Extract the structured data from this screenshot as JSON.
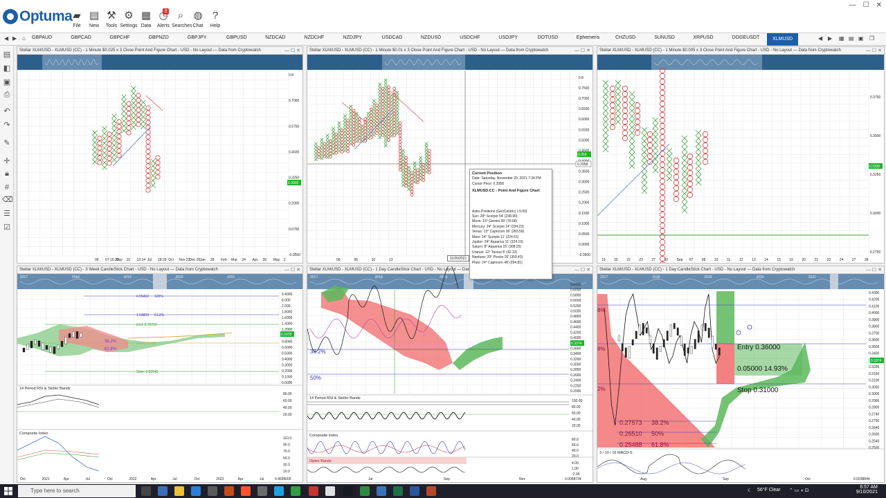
{
  "app": {
    "logo_text": "Optuma",
    "ribbon": [
      {
        "label": "File",
        "icon": "folder-icon"
      },
      {
        "label": "New",
        "icon": "new-page-icon"
      },
      {
        "label": "Tools",
        "icon": "tools-icon"
      },
      {
        "label": "Settings",
        "icon": "gear-icon"
      },
      {
        "label": "Data",
        "icon": "data-icon"
      },
      {
        "label": "Alerts",
        "icon": "clock-icon",
        "badge": "3"
      },
      {
        "label": "Searches",
        "icon": "search-icon"
      },
      {
        "label": "Chat",
        "icon": "chat-icon"
      },
      {
        "label": "Help",
        "icon": "help-icon"
      }
    ],
    "accent": "#1c5fa8"
  },
  "tabs": {
    "items": [
      "GBPAUD",
      "GBPCAD",
      "GBPCHF",
      "GBPNZD",
      "GBPJPY",
      "GBPUSD",
      "NZDCAD",
      "NZDCHF",
      "NZDJPY",
      "USDCAD",
      "NZDUSD",
      "USDCHF",
      "USDJPY",
      "DOTUSD",
      "Ephemeris",
      "CHZUSD",
      "SUNUSD",
      "XRPUSD",
      "DOGEUSDT",
      "XLMUSD"
    ],
    "active": "XLMUSD"
  },
  "panels": [
    {
      "title": "Stellar XLM/USD - XLMUSD (CC) - 1 Minute $0.025 x 3 Close Point And Figure Chart - USD - No Layout — Data from Cryptowatch",
      "yticks": [
        "0.8",
        "0.7000",
        "0.5750",
        "0.4500",
        "0.3250",
        "0.2000",
        "0.0750",
        "-0.0500"
      ],
      "xticks": [
        "06",
        "07:16:23",
        "May",
        "10",
        "13:14",
        "Jul",
        "18:29",
        "Oct",
        "Nov 23",
        "Dec 26",
        "Jan",
        "28",
        "Feb",
        "Mar",
        "24",
        "Apr",
        "26",
        "May",
        "2"
      ],
      "price_tag": "0.3000"
    },
    {
      "title": "Stellar XLM/USD - XLMUSD (CC) - 1 Minute $0.01 x 3 Close Point And Figure Chart - USD - No Layout — Data from Cryptowatch",
      "yticks": [
        "0.8",
        "0.7500",
        "0.7000",
        "0.6500",
        "0.6000",
        "0.5500",
        "0.5000",
        "0.4500",
        "0.4000",
        "0.3500",
        "0.3000",
        "0.2500",
        "0.2000",
        "0.1500",
        "0.1000",
        "0.0500",
        "0.0000",
        "-0.0500"
      ],
      "xticks": [
        "06",
        "06",
        "10",
        "13"
      ],
      "price_tag": "0.350",
      "cursor_tag": "0.2958",
      "date_tag": "11/20/2021"
    },
    {
      "title": "Stellar XLM/USD - XLMUSD (CC) - 1 Minute $0.005 x 3 Close Point And Figure Chart - USD - No Layout — Data from Cryptowatch",
      "yticks": [
        "0.3750",
        "0.3500",
        "0.3250",
        "0.3000",
        "0.2750"
      ],
      "xticks": [
        "19",
        "20",
        "22",
        "23",
        "27",
        "30",
        "Sep",
        "07",
        "08",
        "10",
        "11",
        "12",
        "13",
        "14",
        "15",
        "16",
        "20",
        "21",
        "23",
        "24",
        "27",
        "28"
      ],
      "price_tag": "0.3330"
    },
    {
      "title": "Stellar XLM/USD - XLMUSD (CC) - 3 Week CandleStick Chart - USD - No Layout — Data from Cryptowatch",
      "yticks": [
        "6.4000",
        "6.000",
        "2.000",
        "1.8000",
        "1.6000",
        "1.4000",
        "1.2000",
        "1.0000",
        "0.8000",
        "0.6000",
        "0.5000",
        "0.4000",
        "0.3000",
        "0.2000",
        "0.1000",
        "0.0000"
      ],
      "fib": [
        {
          "value": "6.05452",
          "pct": "100%"
        },
        {
          "value": "1.64803",
          "pct": "61.8%"
        }
      ],
      "fib_labels": [
        "End: 0.79760",
        "Ext: 0.20078",
        "Start: 0.02645",
        "38.2%",
        "61.8%"
      ],
      "sub1": "14 Period RSI & Stoller Bands",
      "sub1_ticks": [
        "80.00",
        "60.00",
        "40.00",
        "20.00"
      ],
      "sub2": "Composite Index",
      "sub2_ticks": [
        "110.0",
        "90.0",
        "70.0",
        "50.0",
        "30.0",
        "10.0"
      ],
      "xticks": [
        "Oct",
        "2021",
        "Apr",
        "Jul",
        "Oct",
        "2022",
        "Apr",
        "Jul",
        "Oct",
        "2023",
        "Apr",
        "Jul"
      ],
      "price_tag": "0.3378",
      "corner": "0.4695005",
      "nav": [
        "2017",
        "2018",
        "2019",
        "2020",
        "2021"
      ]
    },
    {
      "title": "Stellar XLM/USD - XLMUSD (CC) - 1 Day CandleStick Chart - USD - No Layout — Data from Cryptowatch",
      "yticks": [
        "0.6400",
        "0.6000",
        "0.5800",
        "0.5600",
        "0.5200",
        "0.5000",
        "0.4800",
        "0.4600",
        "0.4400",
        "0.4200",
        "0.4000",
        "0.3800",
        "0.3600",
        "0.3400",
        "0.3200",
        "0.3000",
        "0.2800",
        "0.2600",
        "0.2400",
        "0.2200",
        "0.2000"
      ],
      "labels": [
        "38.2%",
        "50%"
      ],
      "sub1": "14 Period RSI & Stoller Bands",
      "sub1_ticks": [
        "100.00",
        "80.00",
        "60.00",
        "40.00",
        "20.00"
      ],
      "sub2": "Composite Index",
      "sub2_ticks": [
        "80.0",
        "60.0",
        "40.0",
        "20.0"
      ],
      "sub3": "Optex Bands",
      "sub3_ticks": [
        "4.00",
        "1.00",
        "-2.00"
      ],
      "xticks": [
        "Jul",
        "Sep",
        "Nov"
      ],
      "price_tag": "0.3374",
      "corner": "0.0058734",
      "nav": [
        "2017",
        "2018",
        "2019",
        "2020"
      ]
    },
    {
      "title": "Stellar XLM/USD - XLMUSD (CC) - 1 Day CandleStick Chart - USD - No Layout — Data from Cryptowatch",
      "yticks": [
        "0.4300",
        "0.4200",
        "0.4100",
        "0.4000",
        "0.3900",
        "0.3800",
        "0.3700",
        "0.3600",
        "0.3500",
        "0.3400",
        "0.3300",
        "0.3200",
        "0.3150",
        "0.3100",
        "0.3050",
        "0.3000",
        "0.2900",
        "0.2800",
        "0.2740",
        "0.2700",
        "0.2640",
        "0.2600",
        "0.2540",
        "0.2500"
      ],
      "entry": "Entry  0.36000",
      "target": "0.05000  14.93%",
      "stop": "Stop  0.31000",
      "fibs": [
        {
          "value": "0.27573",
          "pct": "38.2%"
        },
        {
          "value": "0.26510",
          "pct": "50%"
        },
        {
          "value": "0.25488",
          "pct": "61.8%"
        }
      ],
      "left_pcts": [
        "8%",
        "8%",
        "2%"
      ],
      "sub1": "3 / 10 / 16 MACD-S",
      "xticks": [
        "Aug",
        "Sep",
        "Oct"
      ],
      "price_tag": "0.3374",
      "corner": "0.0038844",
      "nav": [
        "2017",
        "2018",
        "2019",
        "2020",
        "2021"
      ]
    }
  ],
  "popup": {
    "heading": "Current Position",
    "date": "Date: Saturday, November 20, 2021 7:24 PM",
    "cursor": "Cursor Price: 0.2958",
    "chart": "XLMUSD.CC - Point And Figure Chart",
    "astro_heading": "Astro Positions (GeoCentric) (-5:00)",
    "astro": [
      "Sun: 28° Scorpio 54' (238.90)",
      "Moon: 16° Gemini 39' (76.66)",
      "Mercury: 24° Scorpio 14' (234.23)",
      "Venus: 13° Capricorn 36' (283.59)",
      "Mars: 14° Scorpio 11' (224.51)",
      "Jupiter: 24° Aquarius 11' (324.19)",
      "Saturn: 8° Aquarius 15' (308.25)",
      "Uranus: 12° Taurus 8' (42.13)",
      "Neptune: 20° Pisces 26' (350.43)",
      "Pluto: 24° Capricorn 48' (294.81)"
    ]
  },
  "taskbar": {
    "search_placeholder": "Type here to search",
    "weather": "56°F  Clear",
    "time": "6:57 AM",
    "date": "9/10/2021"
  }
}
